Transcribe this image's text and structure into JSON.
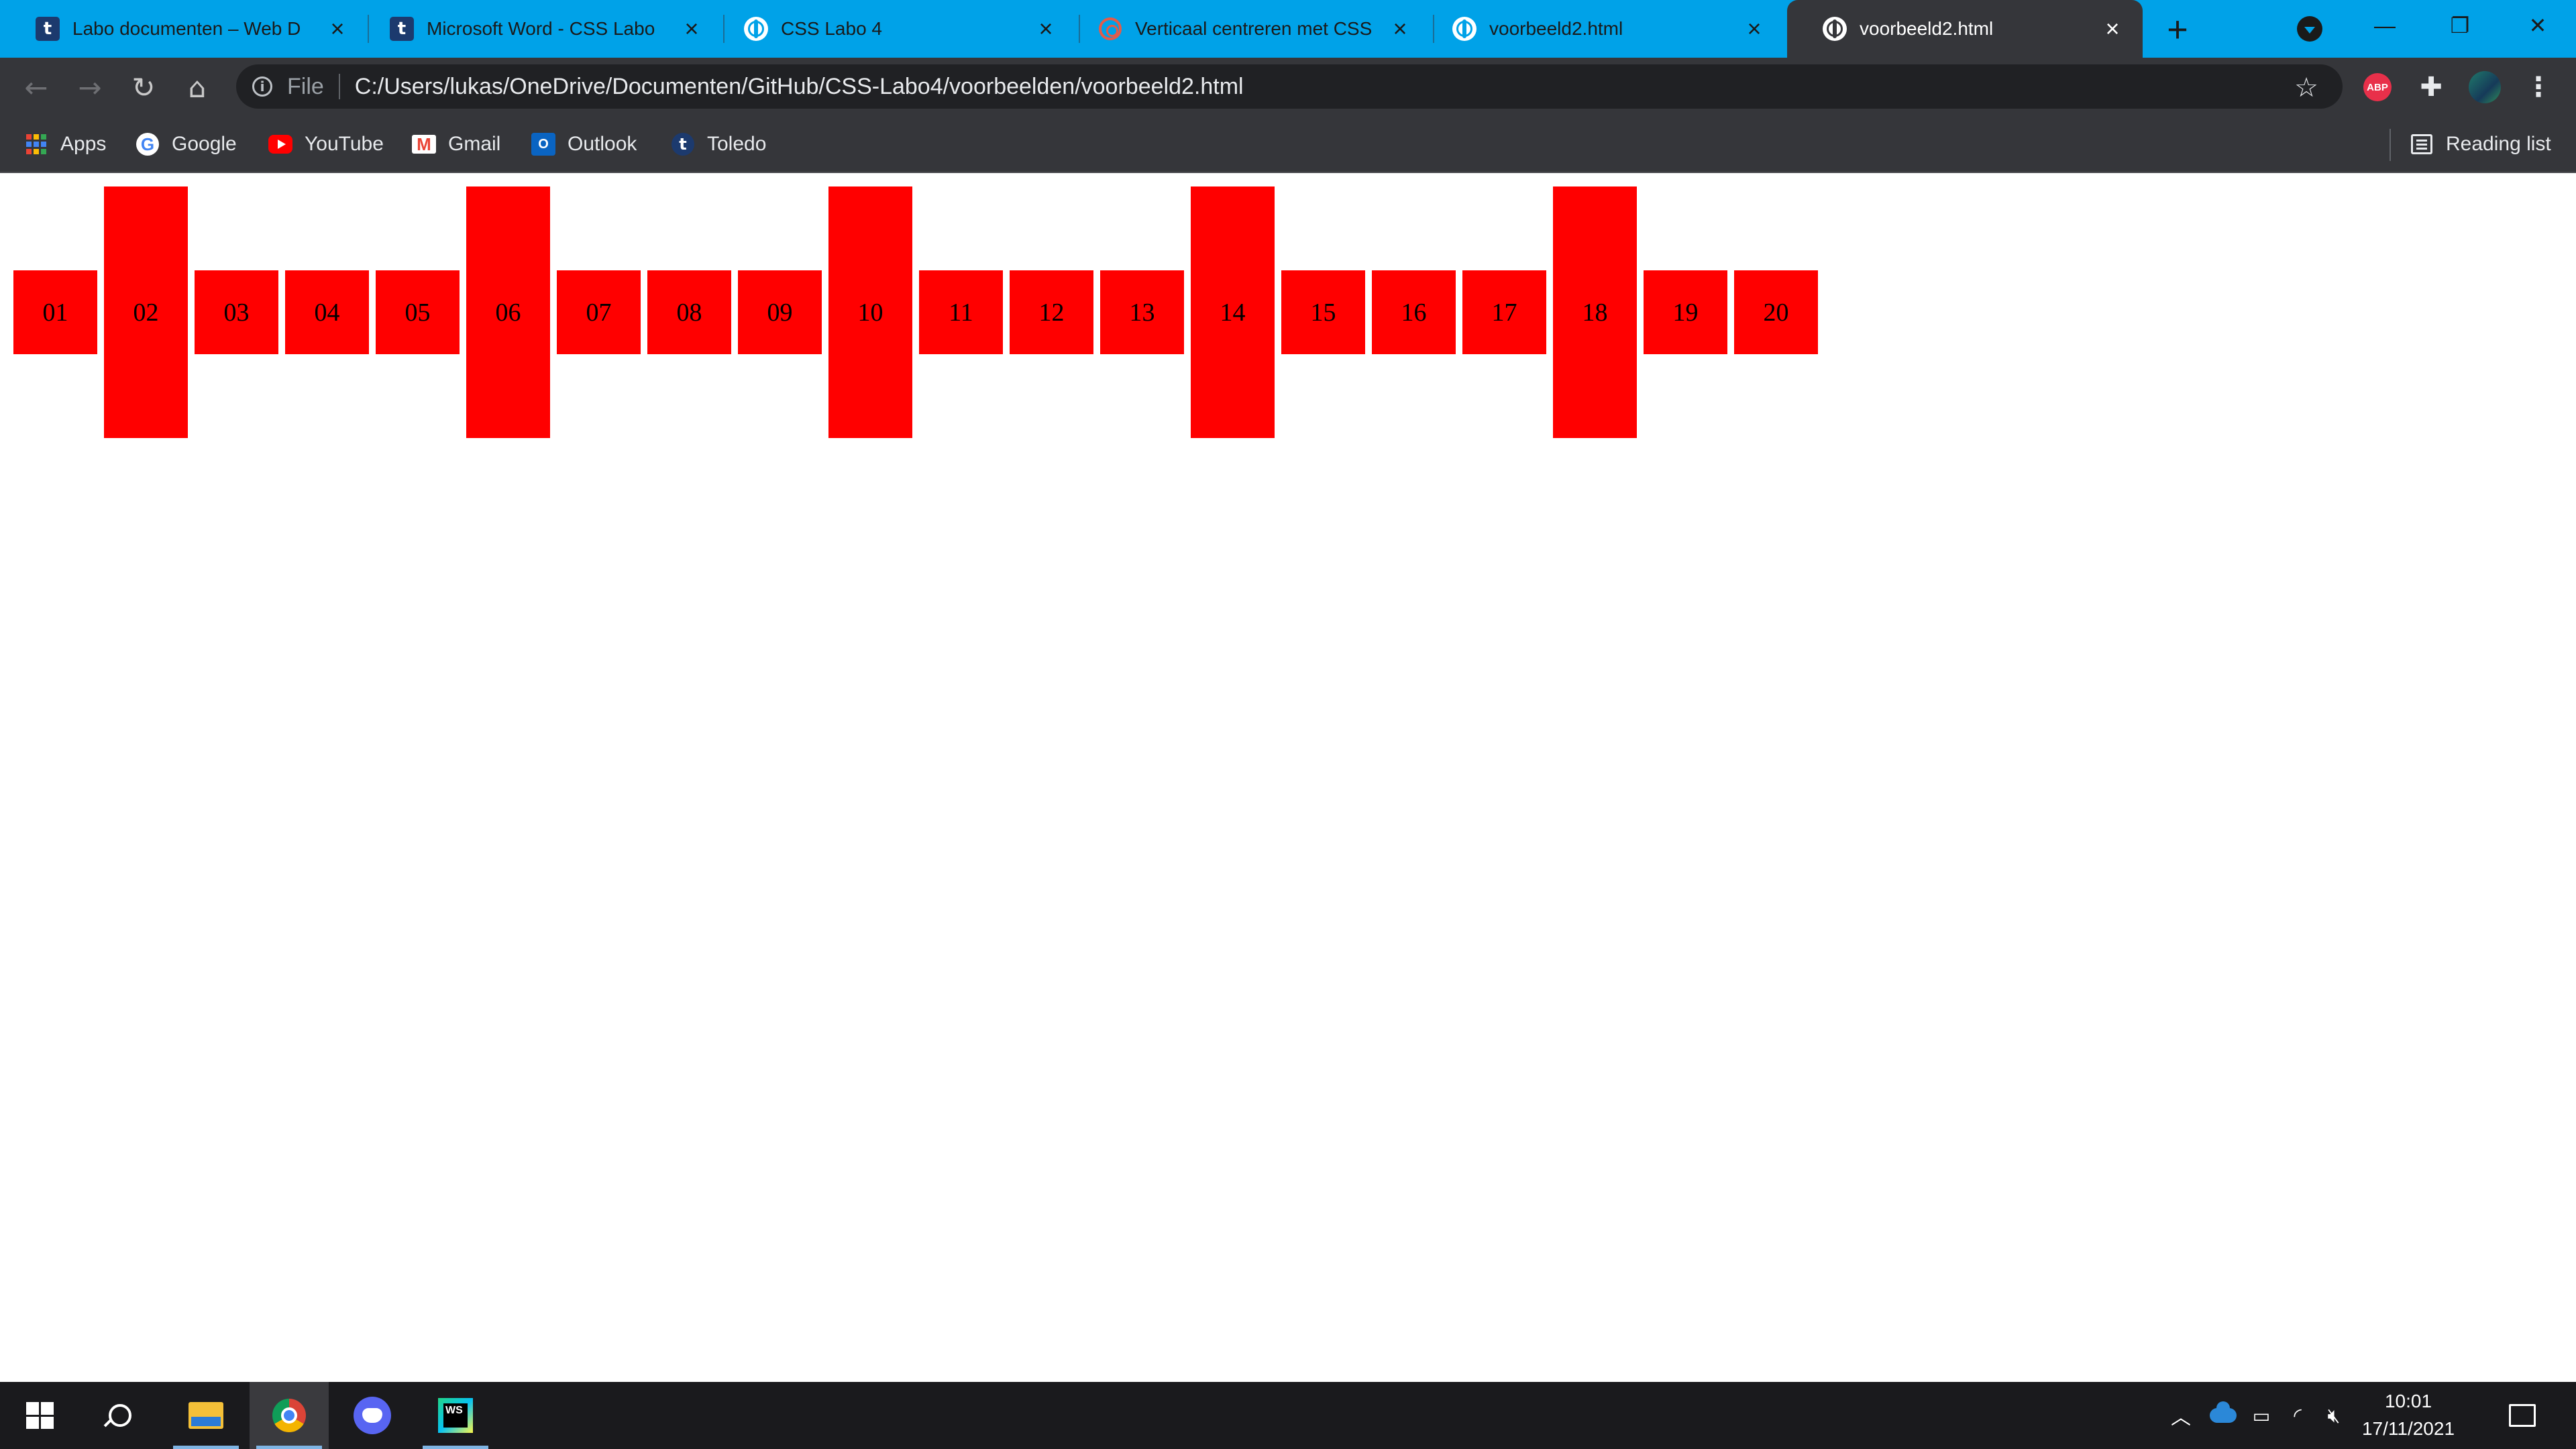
{
  "tabs": [
    {
      "title": "Labo documenten – Web D",
      "icon": "toledo-icon",
      "active": false
    },
    {
      "title": "Microsoft Word - CSS Labo",
      "icon": "toledo-icon",
      "active": false
    },
    {
      "title": "CSS Labo 4",
      "icon": "globe-icon",
      "active": false
    },
    {
      "title": "Verticaal centreren met CSS",
      "icon": "ring-icon",
      "active": false
    },
    {
      "title": "voorbeeld2.html",
      "icon": "globe-icon",
      "active": false
    },
    {
      "title": "voorbeeld2.html",
      "icon": "globe-icon",
      "active": true
    }
  ],
  "toolbar": {
    "scheme": "File",
    "url": "C:/Users/lukas/OneDrive/Documenten/GitHub/CSS-Labo4/voorbeelden/voorbeeld2.html",
    "abp_label": "ABP"
  },
  "bookmarks": {
    "items": [
      "Apps",
      "Google",
      "YouTube",
      "Gmail",
      "Outlook",
      "Toledo"
    ],
    "reading_list": "Reading list"
  },
  "page": {
    "boxes": [
      {
        "label": "01",
        "tall": false
      },
      {
        "label": "02",
        "tall": true
      },
      {
        "label": "03",
        "tall": false
      },
      {
        "label": "04",
        "tall": false
      },
      {
        "label": "05",
        "tall": false
      },
      {
        "label": "06",
        "tall": true
      },
      {
        "label": "07",
        "tall": false
      },
      {
        "label": "08",
        "tall": false
      },
      {
        "label": "09",
        "tall": false
      },
      {
        "label": "10",
        "tall": true
      },
      {
        "label": "11",
        "tall": false
      },
      {
        "label": "12",
        "tall": false
      },
      {
        "label": "13",
        "tall": false
      },
      {
        "label": "14",
        "tall": true
      },
      {
        "label": "15",
        "tall": false
      },
      {
        "label": "16",
        "tall": false
      },
      {
        "label": "17",
        "tall": false
      },
      {
        "label": "18",
        "tall": true
      },
      {
        "label": "19",
        "tall": false
      },
      {
        "label": "20",
        "tall": false
      }
    ],
    "box_color": "#ff0000"
  },
  "taskbar": {
    "apps": [
      "start-icon",
      "search-icon",
      "file-explorer-icon",
      "chrome-icon",
      "discord-icon",
      "webstorm-icon"
    ],
    "ws_label": "WS",
    "time": "10:01",
    "date": "17/11/2021"
  },
  "colors": {
    "tabstrip": "#00a2e8",
    "chrome_dark": "#35363a"
  }
}
